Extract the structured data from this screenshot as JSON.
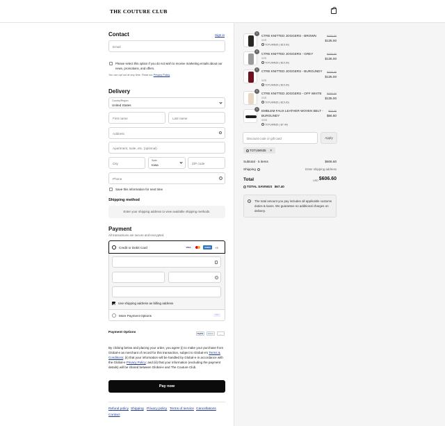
{
  "header": {
    "logo": "THE COUTURE CLUB",
    "bag_icon": "shopping-bag-icon"
  },
  "contact": {
    "title": "Contact",
    "sign_in": "Sign in",
    "email_placeholder": "Email",
    "marketing_opt_out": "Please select this option if you do not wish to receive marketing emails about our news, promotions, and offers.",
    "unsubscribe_prefix": "You can opt out at any time. Read our",
    "privacy_link": "Privacy Policy"
  },
  "delivery": {
    "title": "Delivery",
    "country_label": "Country/Region",
    "country_value": "United States",
    "first_name": "First name",
    "last_name": "Last name",
    "address": "Address",
    "apartment": "Apartment, suite, etc. (optional)",
    "city": "City",
    "state_label": "State",
    "state_value": "Iowa",
    "zip": "ZIP code",
    "phone": "Phone",
    "save_info": "Save this information for next time"
  },
  "shipping": {
    "title": "Shipping method",
    "message": "Enter your shipping address to view available shipping methods."
  },
  "payment": {
    "title": "Payment",
    "subtitle": "All transactions are secure and encrypted.",
    "card_option": "Credit or Debit Card",
    "card_brands": [
      "VISA",
      "MC",
      "AMEX"
    ],
    "more_cards": "+3",
    "billing_same": "Use shipping address as billing address",
    "more_options": "More Payment Options",
    "options_title": "Payment Options",
    "wallets": [
      "PayPal",
      "Venmo",
      "..."
    ]
  },
  "legal": {
    "p1": "By clicking below and placing your order, you agree (i) to make your purchase from Global-e as merchant of record for this transaction, subject to Global-e's",
    "terms_link": "Terms & Conditions",
    "p2": "; (ii) that your information will be handled by Global-e in accordance with the Global-e",
    "privacy_link": "Privacy Policy",
    "p3": "; and (iii) that your information (excluding the payment details) will be shared between Global-e and The Couture Club."
  },
  "pay_button": "Pay now",
  "footer": [
    "Refund policy",
    "Shipping",
    "Privacy policy",
    "Terms of service",
    "Cancellations",
    "Contact"
  ],
  "items": [
    {
      "qty": "1",
      "name": "CTRE KNITTED JOGGERS - BROWN",
      "size": "XXS",
      "discount": "TOTUMN35 (-$15.00)",
      "was": "$150.00",
      "now": "$135.00",
      "color": "#2a2723"
    },
    {
      "qty": "1",
      "name": "CTRE KNITTED JOGGERS - GREY",
      "size": "XXS",
      "discount": "TOTUMN35 (-$15.00)",
      "was": "$150.00",
      "now": "$135.00",
      "color": "#9a9a9a"
    },
    {
      "qty": "1",
      "name": "CTRE KNITTED JOGGERS - BURGUNDY",
      "size": "XXS",
      "discount": "TOTUMN35 (-$15.00)",
      "was": "$150.00",
      "now": "$135.00",
      "color": "#6e1020"
    },
    {
      "qty": "1",
      "name": "CTRE KNITTED JOGGERS - OFF WHITE",
      "size": "XXS",
      "discount": "TOTUMN35 (-$15.00)",
      "was": "$150.00",
      "now": "$135.00",
      "color": "#e7d8c4"
    },
    {
      "qty": "1",
      "name": "EMBLEM FAUX LEATHER WOVEN BELT - BURGUNDY",
      "size": "XS/S",
      "discount": "TOTUMN35 (-$7.40)",
      "was": "$74.00",
      "now": "$66.60",
      "color": "#1b1b1b"
    }
  ],
  "discount": {
    "placeholder": "Discount code or gift card",
    "apply": "Apply",
    "applied_code": "TOTUMN35"
  },
  "totals": {
    "subtotal_label": "Subtotal · 5 items",
    "subtotal_value": "$606.60",
    "shipping_label": "Shipping",
    "shipping_value": "Enter shipping address",
    "total_label": "Total",
    "currency": "USD",
    "total_value": "$606.60",
    "savings_label": "TOTAL SAVINGS",
    "savings_value": "$67.40"
  },
  "notice": "The total amount you pay includes all applicable customs duties & taxes. We guarantee no additional charges on delivery."
}
